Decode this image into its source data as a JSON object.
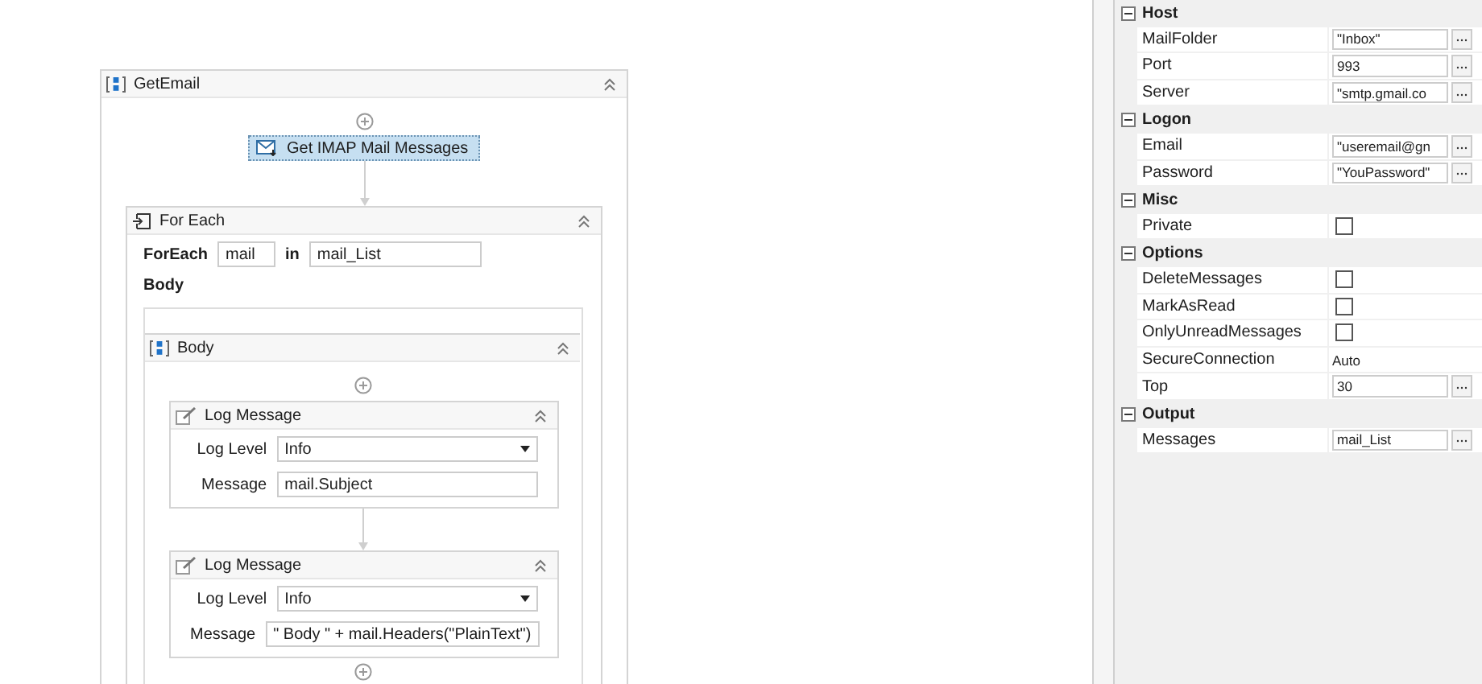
{
  "workflow": {
    "title": "GetEmail",
    "activity": "Get IMAP Mail Messages",
    "for_each": {
      "title": "For Each",
      "label": "ForEach",
      "item": "mail",
      "in_label": "in",
      "list": "mail_List",
      "body_label": "Body",
      "body": {
        "title": "Body",
        "activities": [
          {
            "title": "Log Message",
            "fields": [
              {
                "kind": "dropdown",
                "label": "Log Level",
                "value": "Info"
              },
              {
                "kind": "text",
                "label": "Message",
                "value": "mail.Subject"
              }
            ]
          },
          {
            "title": "Log Message",
            "fields": [
              {
                "kind": "dropdown",
                "label": "Log Level",
                "value": "Info"
              },
              {
                "kind": "text",
                "label": "Message",
                "value": "\" Body \" + mail.Headers(\"PlainText\")"
              }
            ]
          }
        ]
      }
    }
  },
  "properties": {
    "categories": [
      {
        "name": "Host",
        "expanded": true,
        "rows": [
          {
            "name": "MailFolder",
            "kind": "text",
            "value": "\"Inbox\""
          },
          {
            "name": "Port",
            "kind": "text",
            "value": "993"
          },
          {
            "name": "Server",
            "kind": "text",
            "value": "\"smtp.gmail.co"
          }
        ]
      },
      {
        "name": "Logon",
        "expanded": true,
        "rows": [
          {
            "name": "Email",
            "kind": "text",
            "value": "\"useremail@gn"
          },
          {
            "name": "Password",
            "kind": "text",
            "value": "\"YouPassword\""
          }
        ]
      },
      {
        "name": "Misc",
        "expanded": true,
        "rows": [
          {
            "name": "Private",
            "kind": "checkbox",
            "checked": false
          }
        ]
      },
      {
        "name": "Options",
        "expanded": true,
        "rows": [
          {
            "name": "DeleteMessages",
            "kind": "checkbox",
            "checked": false
          },
          {
            "name": "MarkAsRead",
            "kind": "checkbox",
            "checked": false
          },
          {
            "name": "OnlyUnreadMessages",
            "kind": "checkbox",
            "checked": false
          },
          {
            "name": "SecureConnection",
            "kind": "plain",
            "value": "Auto"
          },
          {
            "name": "Top",
            "kind": "text",
            "value": "30"
          }
        ]
      },
      {
        "name": "Output",
        "expanded": true,
        "rows": [
          {
            "name": "Messages",
            "kind": "text",
            "value": "mail_List"
          }
        ]
      }
    ]
  }
}
